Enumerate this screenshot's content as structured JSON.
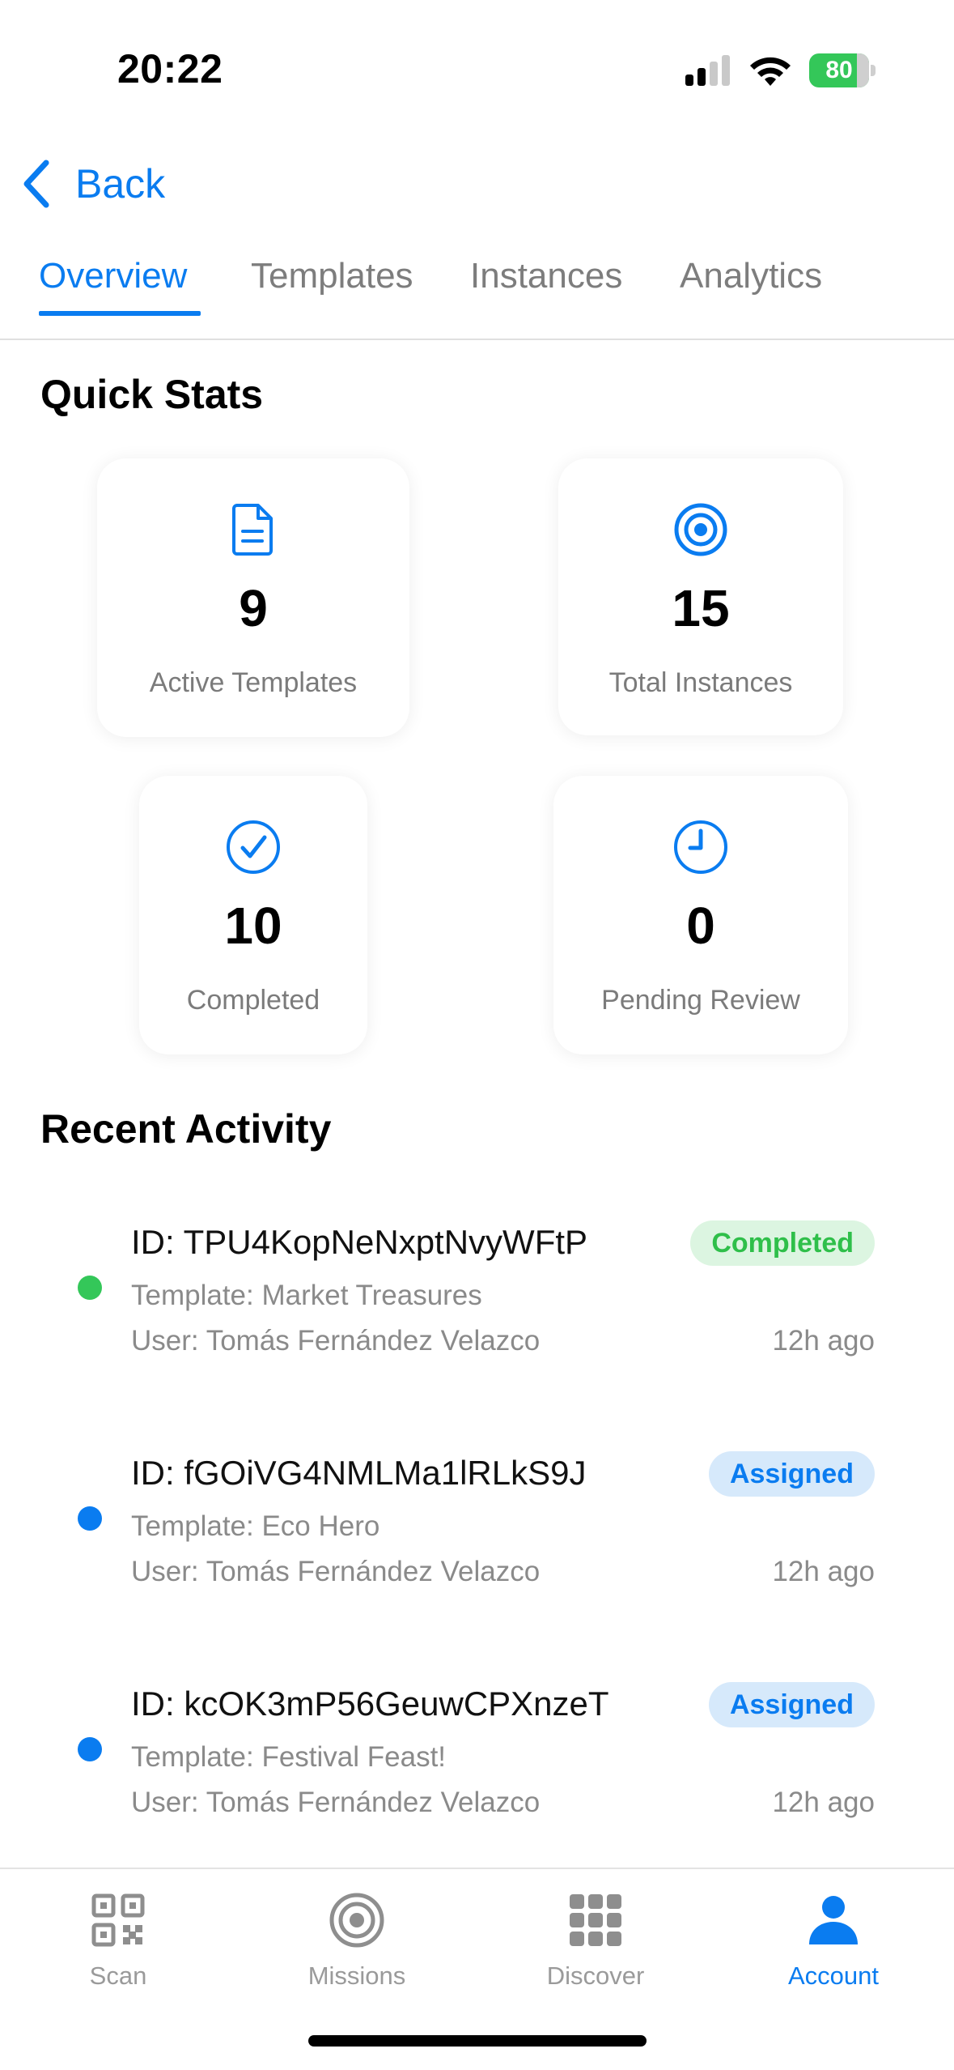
{
  "status_bar": {
    "time": "20:22",
    "battery": "80",
    "battery_level": 0.8
  },
  "nav": {
    "back_label": "Back"
  },
  "tabs": [
    {
      "label": "Overview",
      "active": true
    },
    {
      "label": "Templates",
      "active": false
    },
    {
      "label": "Instances",
      "active": false
    },
    {
      "label": "Analytics",
      "active": false
    }
  ],
  "quick_stats": {
    "title": "Quick Stats",
    "cards": [
      {
        "icon": "document-icon",
        "value": "9",
        "label": "Active Templates"
      },
      {
        "icon": "target-icon",
        "value": "15",
        "label": "Total Instances"
      },
      {
        "icon": "check-circle-icon",
        "value": "10",
        "label": "Completed"
      },
      {
        "icon": "clock-icon",
        "value": "0",
        "label": "Pending Review"
      }
    ]
  },
  "recent_activity": {
    "title": "Recent Activity",
    "items": [
      {
        "id": "ID: TPU4KopNeNxptNvyWFtP",
        "template": "Template: Market Treasures",
        "user": "User: Tomás Fernández Velazco",
        "time": "12h ago",
        "status": "Completed",
        "dot_color": "#34c759"
      },
      {
        "id": "ID: fGOiVG4NMLMa1lRLkS9J",
        "template": "Template: Eco Hero",
        "user": "User: Tomás Fernández Velazco",
        "time": "12h ago",
        "status": "Assigned",
        "dot_color": "#0a7cf0"
      },
      {
        "id": "ID: kcOK3mP56GeuwCPXnzeT",
        "template": "Template: Festival Feast!",
        "user": "User: Tomás Fernández Velazco",
        "time": "12h ago",
        "status": "Assigned",
        "dot_color": "#0a7cf0"
      }
    ]
  },
  "tab_bar": [
    {
      "label": "Scan",
      "icon": "qr-code-icon",
      "active": false
    },
    {
      "label": "Missions",
      "icon": "target-icon",
      "active": false
    },
    {
      "label": "Discover",
      "icon": "grid-icon",
      "active": false
    },
    {
      "label": "Account",
      "icon": "person-icon",
      "active": true
    }
  ],
  "colors": {
    "accent": "#0a7cf0",
    "success": "#34c759",
    "muted": "#8a8a8a"
  }
}
